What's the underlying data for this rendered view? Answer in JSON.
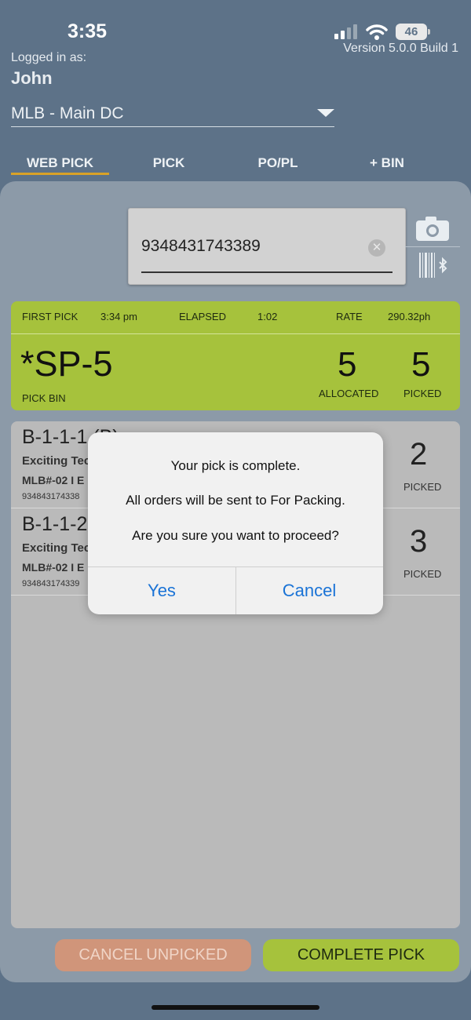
{
  "status_bar": {
    "time": "3:35",
    "battery": "46"
  },
  "header": {
    "version": "Version 5.0.0 Build 1",
    "logged_in_label": "Logged in as:",
    "user": "John",
    "location": "MLB - Main DC"
  },
  "tabs": [
    {
      "label": "WEB PICK",
      "active": true
    },
    {
      "label": "PICK",
      "active": false
    },
    {
      "label": "PO/PL",
      "active": false
    },
    {
      "label": "+ BIN",
      "active": false
    }
  ],
  "scan": {
    "value": "9348431743389"
  },
  "stats": {
    "first_pick_label": "FIRST PICK",
    "first_pick_time": "3:34 pm",
    "elapsed_label": "ELAPSED",
    "elapsed_value": "1:02",
    "rate_label": "RATE",
    "rate_value": "290.32ph",
    "pick_bin": "*SP-5",
    "pick_bin_label": "PICK BIN",
    "allocated": "5",
    "allocated_label": "ALLOCATED",
    "picked": "5",
    "picked_label": "PICKED"
  },
  "items": [
    {
      "bin": "B-1-1-1 (B)",
      "name": "Exciting Tec",
      "order": "MLB#-02 I E",
      "barcode": "934843174338",
      "count": "2",
      "count_label": "PICKED"
    },
    {
      "bin": "B-1-1-2",
      "name": "Exciting Tec",
      "order": "MLB#-02 I E",
      "barcode": "934843174339",
      "count": "3",
      "count_label": "PICKED"
    }
  ],
  "buttons": {
    "cancel_unpicked": "CANCEL UNPICKED",
    "complete_pick": "COMPLETE PICK"
  },
  "alert": {
    "line1": "Your pick is complete.",
    "line2": "All orders will be sent to For Packing.",
    "line3": "Are you sure you want to proceed?",
    "yes": "Yes",
    "cancel": "Cancel"
  },
  "colors": {
    "accent_green": "#a6c23c",
    "tab_underline": "#d9a227",
    "link_blue": "#1a73d6",
    "cancel_orange": "#d0957a"
  },
  "icons": [
    "signal-icon",
    "wifi-icon",
    "camera-icon",
    "bluetooth-barcode-icon",
    "clear-icon",
    "chevron-down-icon"
  ]
}
